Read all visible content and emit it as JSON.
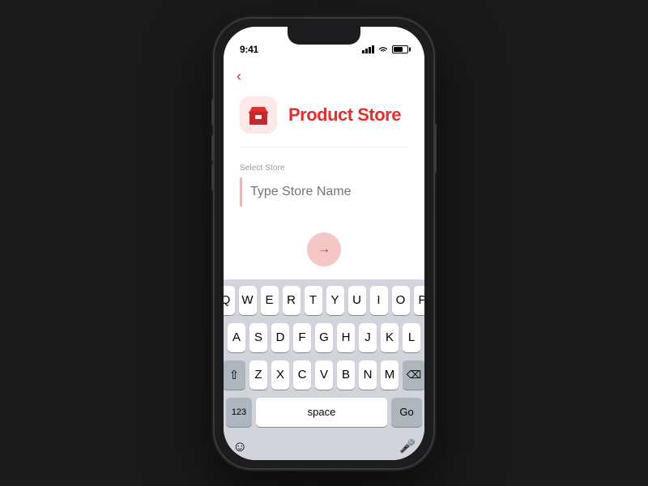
{
  "status": {
    "time": "9:41",
    "wifi": "WiFi",
    "battery_level": "70"
  },
  "nav": {
    "back_label": "‹"
  },
  "header": {
    "title": "Product Store",
    "icon_name": "store-icon"
  },
  "form": {
    "label": "Select Store",
    "placeholder": "Type Store Name"
  },
  "next_button": {
    "arrow": "→"
  },
  "keyboard": {
    "row1": [
      "Q",
      "W",
      "E",
      "R",
      "T",
      "Y",
      "U",
      "I",
      "O",
      "P"
    ],
    "row2": [
      "A",
      "S",
      "D",
      "F",
      "G",
      "H",
      "J",
      "K",
      "L"
    ],
    "row3": [
      "Z",
      "X",
      "C",
      "V",
      "B",
      "N",
      "M"
    ],
    "special_left": "123",
    "space": "space",
    "special_right": "Go",
    "shift_icon": "⇧",
    "delete_icon": "⌫",
    "emoji_icon": "☺",
    "mic_icon": "🎤"
  },
  "colors": {
    "accent": "#e03030",
    "accent_light": "#fce8e8",
    "accent_border": "#e8b8b8",
    "next_btn_bg": "#f5c6c6"
  }
}
